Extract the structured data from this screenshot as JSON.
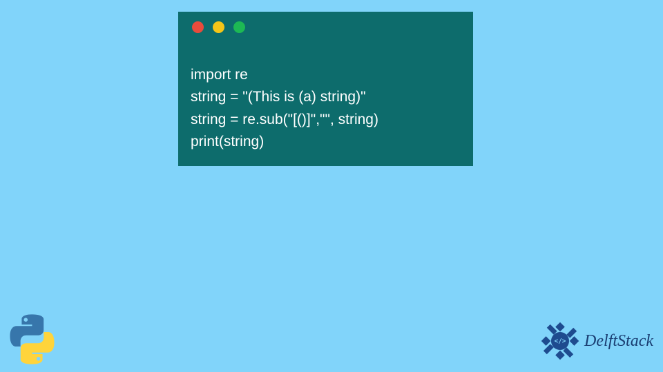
{
  "code_window": {
    "traffic_lights": [
      {
        "name": "close",
        "color": "red"
      },
      {
        "name": "minimize",
        "color": "yellow"
      },
      {
        "name": "maximize",
        "color": "green"
      }
    ],
    "code_lines": [
      "import re",
      "string = \"(This is (a) string)\"",
      "string = re.sub(\"[()]\",\"\", string)",
      "print(string)"
    ]
  },
  "logos": {
    "python_alt": "Python logo",
    "delftstack_alt": "DelftStack logo",
    "delftstack_text": "DelftStack"
  },
  "colors": {
    "background": "#81d4fa",
    "code_bg": "#0d6c6c",
    "code_fg": "#ffffff",
    "brand_text": "#1a3e72"
  }
}
